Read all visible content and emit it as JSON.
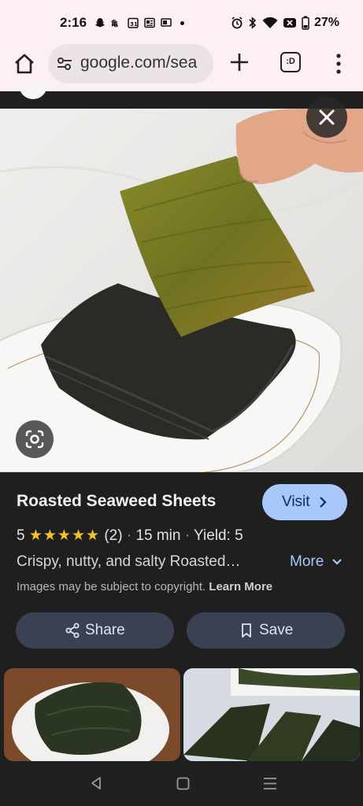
{
  "status_bar": {
    "time": "2:16",
    "battery": "27%"
  },
  "browser": {
    "url": "google.com/sea",
    "tab_icon_label": ":D"
  },
  "recipe": {
    "title": "Roasted Seaweed Sheets",
    "visit_label": "Visit",
    "rating_value": "5",
    "stars": "★★★★★",
    "review_count": "(2)",
    "time": "15 min",
    "yield": "Yield: 5",
    "description": "Crispy, nutty, and salty Roasted…",
    "more_label": "More",
    "copyright_text": "Images may be subject to copyright.",
    "learn_more_label": "Learn More",
    "share_label": "Share",
    "save_label": "Save"
  },
  "colors": {
    "accent": "#a8c7fa",
    "panel_bg": "#1f1f1f",
    "pill_bg": "#3a4152",
    "star": "#f6c026"
  }
}
